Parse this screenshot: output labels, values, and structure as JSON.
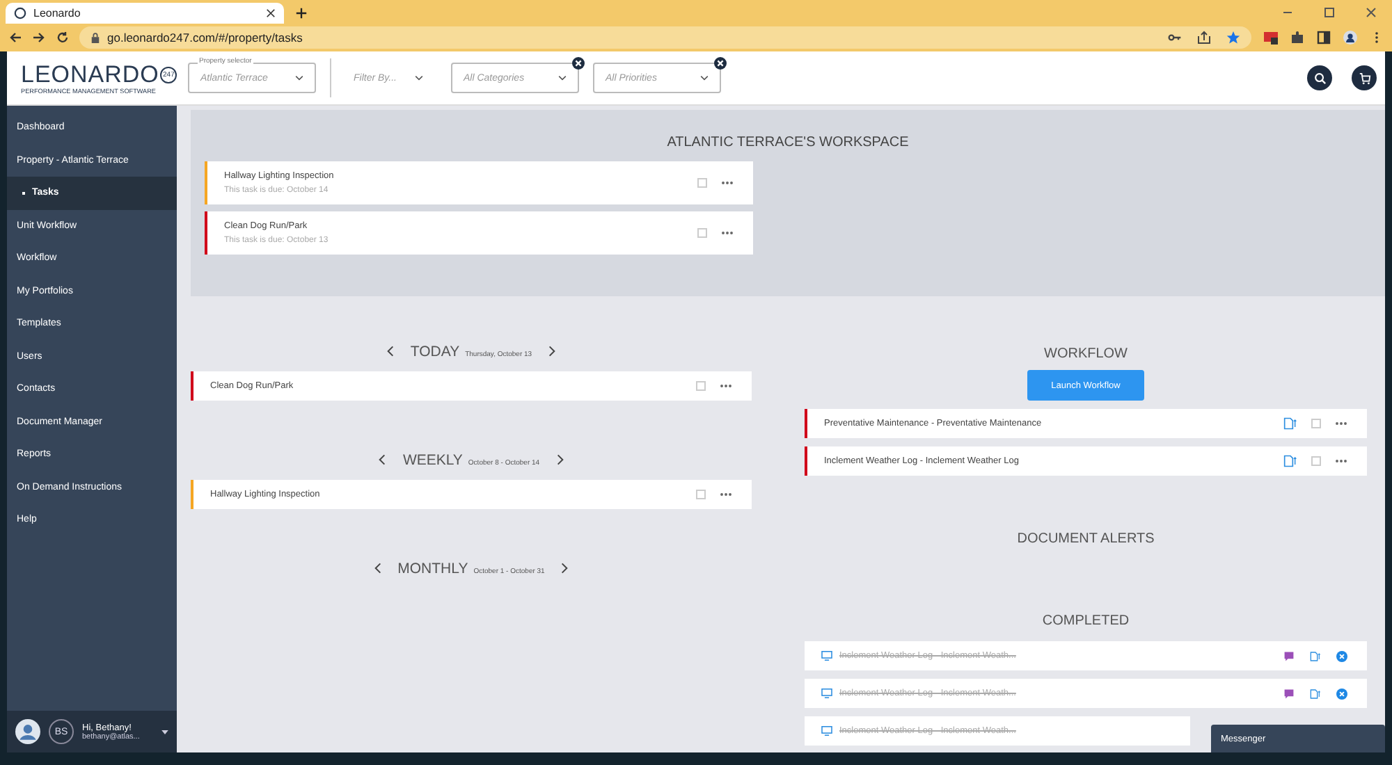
{
  "browser": {
    "tab_title": "Leonardo",
    "url": "go.leonardo247.com/#/property/tasks"
  },
  "header": {
    "logo": "LEONARDO",
    "logo_badge": "247",
    "tagline": "PERFORMANCE MANAGEMENT SOFTWARE",
    "filters": [
      {
        "kind": "select",
        "label": "Property selector",
        "value": "Atlantic Terrace",
        "clearable": false
      },
      {
        "kind": "menu",
        "value": "Filter By..."
      },
      {
        "kind": "select",
        "value": "All Categories",
        "clearable": true
      },
      {
        "kind": "select",
        "value": "All Priorities",
        "clearable": true
      }
    ]
  },
  "sidebar": {
    "items": [
      {
        "label": "Dashboard",
        "kind": "item",
        "selected": false
      },
      {
        "label": "Property - Atlantic Terrace",
        "kind": "item",
        "selected": false
      },
      {
        "label": "Tasks",
        "kind": "subitem",
        "selected": true
      },
      {
        "label": "Unit Workflow",
        "kind": "item",
        "selected": false
      },
      {
        "label": "Workflow",
        "kind": "item",
        "selected": false
      },
      {
        "label": "My Portfolios",
        "kind": "item",
        "selected": false
      },
      {
        "label": "Templates",
        "kind": "item",
        "selected": false
      },
      {
        "label": "Users",
        "kind": "item",
        "selected": false
      },
      {
        "label": "Contacts",
        "kind": "item",
        "selected": false
      },
      {
        "label": "Document Manager",
        "kind": "item",
        "selected": false
      },
      {
        "label": "Reports",
        "kind": "item",
        "selected": false
      },
      {
        "label": "On Demand Instructions",
        "kind": "item",
        "selected": false
      },
      {
        "label": "Help",
        "kind": "item",
        "selected": false
      }
    ],
    "user": {
      "initials": "BS",
      "greeting": "Hi, Bethany!",
      "email": "bethany@atlas..."
    }
  },
  "workspace": {
    "title": "ATLANTIC TERRACE'S WORKSPACE",
    "tasks": [
      {
        "title": "Hallway Lighting Inspection",
        "due": "This task is due: October 14",
        "color": "#f5a623",
        "checked": false
      },
      {
        "title": "Clean Dog Run/Park",
        "due": "This task is due: October 13",
        "color": "#d0021b",
        "checked": false
      }
    ]
  },
  "periods": [
    {
      "title": "TODAY",
      "range": "Thursday, October 13",
      "tasks": [
        {
          "title": "Clean Dog Run/Park",
          "color": "#d0021b",
          "checked": false
        }
      ]
    },
    {
      "title": "WEEKLY",
      "range": "October 8 - October 14",
      "tasks": [
        {
          "title": "Hallway Lighting Inspection",
          "color": "#f5a623",
          "checked": false
        }
      ]
    },
    {
      "title": "MONTHLY",
      "range": "October 1 - October 31"
    }
  ],
  "workflow": {
    "title": "WORKFLOW",
    "button": "Launch Workflow",
    "rows": [
      {
        "title": "Preventative Maintenance - Preventative Maintenance",
        "color": "#d0021b",
        "checked": false
      },
      {
        "title": "Inclement Weather Log - Inclement Weather Log",
        "color": "#d0021b",
        "checked": false
      }
    ]
  },
  "document_alerts": {
    "title": "DOCUMENT ALERTS"
  },
  "completed": {
    "title": "COMPLETED",
    "rows": [
      {
        "title": "Inclement Weather Log - Inclement Weath...",
        "actions": true
      },
      {
        "title": "Inclement Weather Log - Inclement Weath...",
        "actions": true
      },
      {
        "title": "Inclement Weather Log - Inclement Weath...",
        "actions": false
      }
    ]
  },
  "messenger": {
    "title": "Messenger"
  }
}
